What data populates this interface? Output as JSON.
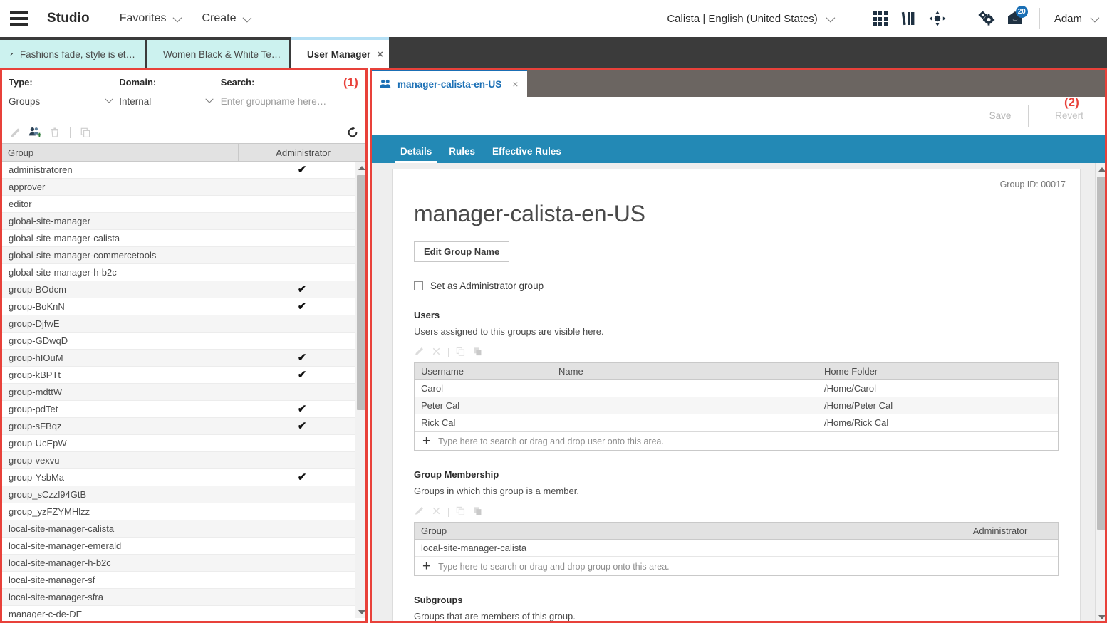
{
  "header": {
    "brand": "Studio",
    "menus": [
      {
        "label": "Favorites",
        "icon": "chevron-down-icon"
      },
      {
        "label": "Create",
        "icon": "chevron-down-icon"
      }
    ],
    "locale": "Calista | English (United States)",
    "user": "Adam",
    "notification_count": "20",
    "icons": [
      "apps-grid-icon",
      "library-icon",
      "target-icon",
      "gears-icon",
      "inbox-icon"
    ]
  },
  "doc_tabs": [
    {
      "label": "Fashions fade, style is et…",
      "icon": "pencil-icon",
      "active": false
    },
    {
      "label": "Women Black & White Te…",
      "icon": "pencil-icon",
      "active": false
    },
    {
      "label": "User Manager",
      "icon": "user-manager-icon",
      "active": true,
      "close": "×"
    }
  ],
  "annotations": [
    {
      "id": "1",
      "label": "(1)"
    },
    {
      "id": "2",
      "label": "(2)"
    }
  ],
  "left_panel": {
    "filters": {
      "type": {
        "label": "Type:",
        "value": "Groups"
      },
      "domain": {
        "label": "Domain:",
        "value": "Internal"
      },
      "search": {
        "label": "Search:",
        "placeholder": "Enter groupname here…",
        "value": ""
      }
    },
    "toolbar": [
      {
        "name": "edit-icon",
        "enabled": false
      },
      {
        "name": "add-group-icon",
        "enabled": true
      },
      {
        "name": "delete-icon",
        "enabled": false
      },
      {
        "name": "duplicate-icon",
        "enabled": false
      },
      {
        "name": "refresh-icon",
        "enabled": true
      }
    ],
    "columns": [
      "Group",
      "Administrator"
    ],
    "rows": [
      {
        "group": "administratoren",
        "admin": true
      },
      {
        "group": "approver",
        "admin": false
      },
      {
        "group": "editor",
        "admin": false
      },
      {
        "group": "global-site-manager",
        "admin": false
      },
      {
        "group": "global-site-manager-calista",
        "admin": false
      },
      {
        "group": "global-site-manager-commercetools",
        "admin": false
      },
      {
        "group": "global-site-manager-h-b2c",
        "admin": false
      },
      {
        "group": "group-BOdcm",
        "admin": true
      },
      {
        "group": "group-BoKnN",
        "admin": true
      },
      {
        "group": "group-DjfwE",
        "admin": false
      },
      {
        "group": "group-GDwqD",
        "admin": false
      },
      {
        "group": "group-hIOuM",
        "admin": true
      },
      {
        "group": "group-kBPTt",
        "admin": true
      },
      {
        "group": "group-mdttW",
        "admin": false
      },
      {
        "group": "group-pdTet",
        "admin": true
      },
      {
        "group": "group-sFBqz",
        "admin": true
      },
      {
        "group": "group-UcEpW",
        "admin": false
      },
      {
        "group": "group-vexvu",
        "admin": false
      },
      {
        "group": "group-YsbMa",
        "admin": true
      },
      {
        "group": "group_sCzzl94GtB",
        "admin": false
      },
      {
        "group": "group_yzFZYMHlzz",
        "admin": false
      },
      {
        "group": "local-site-manager-calista",
        "admin": false
      },
      {
        "group": "local-site-manager-emerald",
        "admin": false
      },
      {
        "group": "local-site-manager-h-b2c",
        "admin": false
      },
      {
        "group": "local-site-manager-sf",
        "admin": false
      },
      {
        "group": "local-site-manager-sfra",
        "admin": false
      },
      {
        "group": "manager-c-de-DE",
        "admin": false
      }
    ],
    "checkmark": "✔"
  },
  "right_panel": {
    "entity_tab": {
      "label": "manager-calista-en-US",
      "icon": "two-users-icon",
      "close": "×"
    },
    "actions": {
      "save": "Save",
      "revert": "Revert"
    },
    "tabs": [
      {
        "label": "Details",
        "active": true
      },
      {
        "label": "Rules",
        "active": false
      },
      {
        "label": "Effective Rules",
        "active": false
      }
    ],
    "details": {
      "group_id_label": "Group ID: 00017",
      "title": "manager-calista-en-US",
      "edit_name_button": "Edit Group Name",
      "admin_checkbox_label": "Set as Administrator group",
      "users": {
        "title": "Users",
        "description": "Users assigned to this groups are visible here.",
        "columns": [
          "Username",
          "Name",
          "Home Folder"
        ],
        "rows": [
          {
            "username": "Carol",
            "name": "",
            "home": "/Home/Carol"
          },
          {
            "username": "Peter Cal",
            "name": "",
            "home": "/Home/Peter Cal"
          },
          {
            "username": "Rick Cal",
            "name": "",
            "home": "/Home/Rick Cal"
          }
        ],
        "add_hint": "Type here to search or drag and drop user onto this area."
      },
      "group_membership": {
        "title": "Group Membership",
        "description": "Groups in which this group is a member.",
        "columns": [
          "Group",
          "Administrator"
        ],
        "rows": [
          {
            "group": "local-site-manager-calista",
            "admin": ""
          }
        ],
        "add_hint": "Type here to search or drag and drop group onto this area."
      },
      "subgroups": {
        "title": "Subgroups",
        "description": "Groups that are members of this group."
      },
      "mini_toolbar": [
        "edit-icon",
        "remove-icon",
        "copy-icon",
        "paste-icon"
      ],
      "plus": "+"
    }
  },
  "colors": {
    "accent_blue": "#2389b5",
    "link_blue": "#1a6fb5",
    "annotation_red": "#e8413a",
    "tab_cyan": "#ccf2ef",
    "panel_grey": "#6b6561"
  }
}
